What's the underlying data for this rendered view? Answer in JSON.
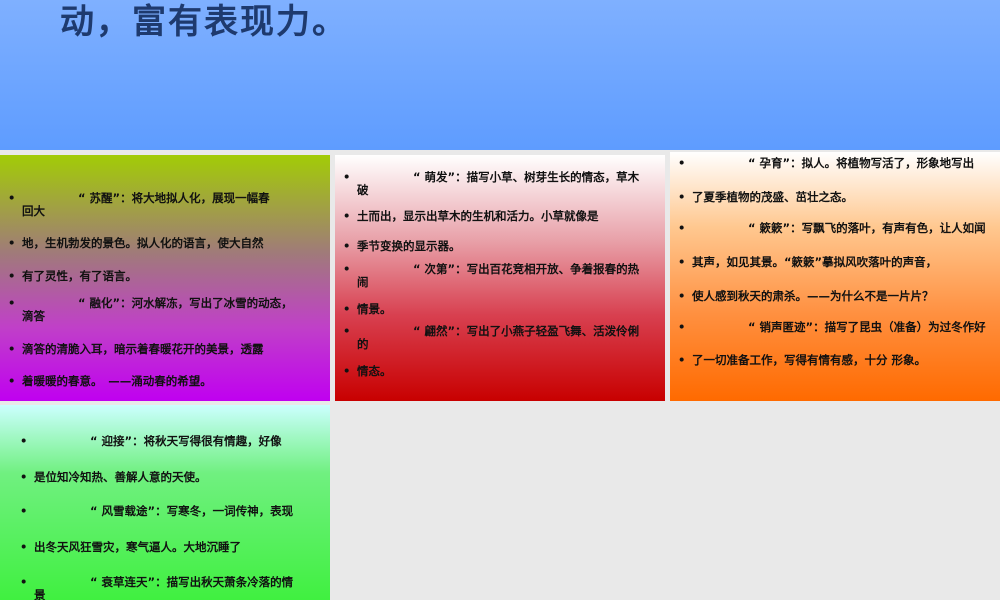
{
  "title": "动，富有表现力。",
  "bullet": "•",
  "panels": [
    {
      "items": [
        {
          "lead": "“ 苏醒”：将大地拟人化，展现一幅春",
          "rest": "回大"
        },
        {
          "lead": "",
          "rest": "地，生机勃发的景色。拟人化的语言，使大自然"
        },
        {
          "lead": "",
          "rest": "有了灵性，有了语言。"
        },
        {
          "lead": "“ 融化”：河水解冻，写出了冰雪的动态，",
          "rest": "滴答"
        },
        {
          "lead": "",
          "rest": "滴答的清脆入耳，暗示着春暖花开的美景，透露"
        },
        {
          "lead": "",
          "rest": "着暖暖的春意。　——涌动春的希望。"
        }
      ]
    },
    {
      "items": [
        {
          "lead": "“ 萌发”：描写小草、树芽生长的情态，草木",
          "rest": "破"
        },
        {
          "lead": "",
          "rest": "土而出，显示出草木的生机和活力。小草就像是"
        },
        {
          "lead": "",
          "rest": "季节变换的显示器。"
        },
        {
          "lead": "“ 次第”：写出百花竞相开放、争着报春的热",
          "rest": "闹"
        },
        {
          "lead": "",
          "rest": "情景。"
        },
        {
          "lead": "“ 翩然”：写出了小燕子轻盈飞舞、活泼伶俐",
          "rest": "的"
        },
        {
          "lead": "",
          "rest": "情态。"
        }
      ]
    },
    {
      "items": [
        {
          "lead": "“ 孕育”：拟人。将植物写活了，形象地写出",
          "rest": ""
        },
        {
          "lead": "",
          "rest": "了夏季植物的茂盛、茁壮之态。"
        },
        {
          "lead": "“ 簌簌”：写飘飞的落叶，有声有色，让人如闻",
          "rest": ""
        },
        {
          "lead": "",
          "rest": "其声，如见其景。“簌簌”摹拟风吹落叶的声音，"
        },
        {
          "lead": "",
          "rest": "使人感到秋天的肃杀。——为什么不是一片片？"
        },
        {
          "lead": "“ 销声匿迹”：描写了昆虫（准备）为过冬作好",
          "rest": ""
        },
        {
          "lead": "",
          "rest": "了一切准备工作，写得有情有感，十分 形象。"
        }
      ]
    },
    {
      "items": [
        {
          "lead": "“ 迎接”：将秋天写得很有情趣，好像",
          "rest": ""
        },
        {
          "lead": "",
          "rest": "是位知冷知热、善解人意的天使。"
        },
        {
          "lead": "“ 风雪载途”：写寒冬，一词传神，表现",
          "rest": ""
        },
        {
          "lead": "",
          "rest": "出冬天风狂雪灾，寒气逼人。大地沉睡了"
        },
        {
          "lead": "“ 衰草连天”：描写出秋天萧条冷落的情",
          "rest": "景"
        }
      ]
    }
  ]
}
